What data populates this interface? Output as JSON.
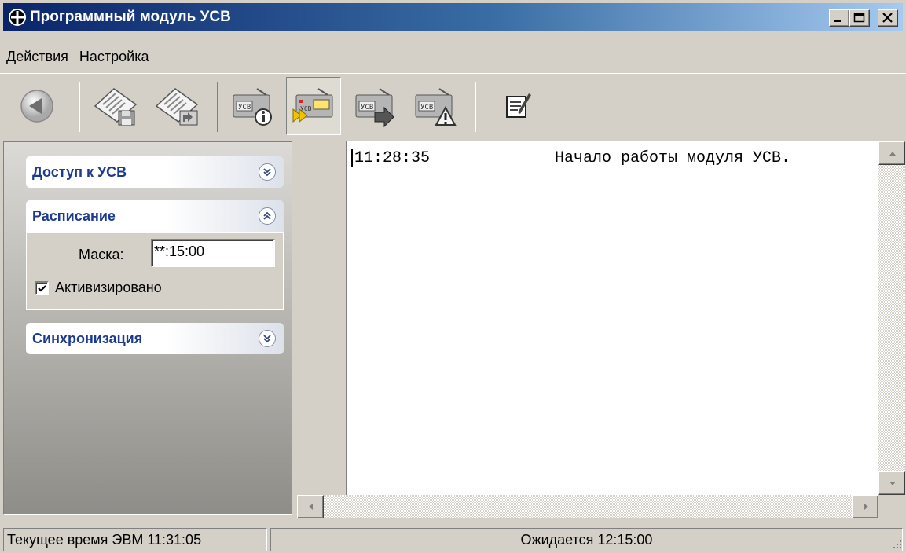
{
  "window": {
    "title": "Программный модуль УСВ",
    "controls": [
      "minimize-icon",
      "maximize-icon",
      "close-icon"
    ]
  },
  "menu": {
    "items": [
      "Действия",
      "Настройка"
    ]
  },
  "toolbar": {
    "buttons": [
      {
        "icon": "back-icon"
      },
      {
        "icon": "save-config-icon"
      },
      {
        "icon": "load-config-icon"
      },
      {
        "icon": "usv-info-icon"
      },
      {
        "icon": "usv-sync-icon",
        "pressed": true
      },
      {
        "icon": "usv-forward-icon"
      },
      {
        "icon": "usv-warning-icon"
      },
      {
        "icon": "edit-notes-icon"
      }
    ]
  },
  "sidebar": {
    "groups": [
      {
        "title": "Доступ к УСВ",
        "expanded": false
      },
      {
        "title": "Расписание",
        "expanded": true
      },
      {
        "title": "Синхронизация",
        "expanded": false
      }
    ],
    "schedule": {
      "mask_label": "Маска:",
      "mask_value": "**:15:00",
      "active_label": "Активизировано",
      "active_checked": true
    }
  },
  "log": {
    "entries": [
      {
        "time": "11:28:35",
        "message": "Начало работы модуля УСВ."
      }
    ]
  },
  "status": {
    "current_time": "Текущее время ЭВМ 11:31:05",
    "waiting": "Ожидается 12:15:00"
  },
  "colors": {
    "title_gradient_start": "#0a246a",
    "title_gradient_end": "#a6caf0",
    "group_title": "#1c3a8f",
    "face": "#d4d0c8"
  }
}
